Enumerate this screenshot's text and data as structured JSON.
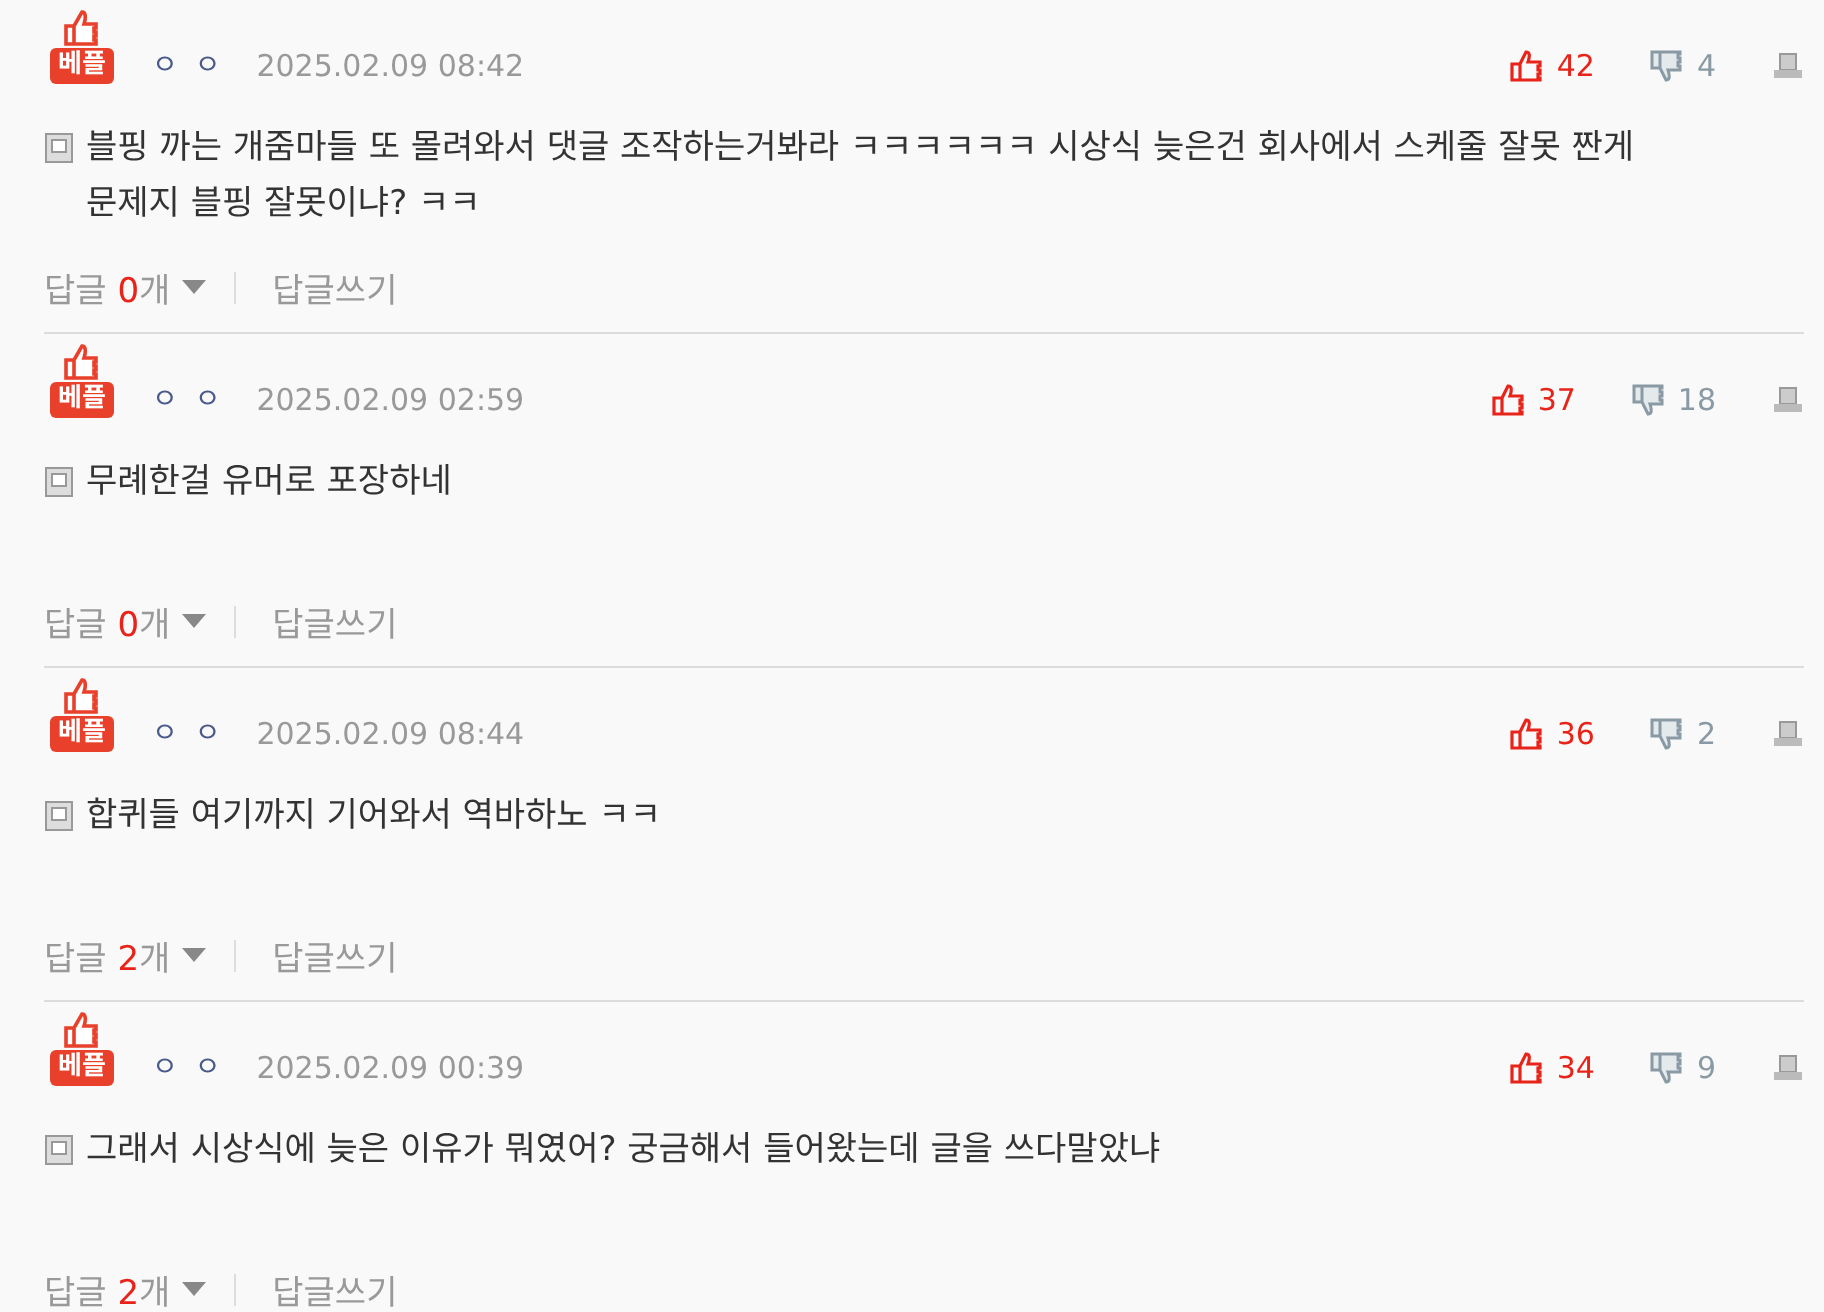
{
  "comments": [
    {
      "badge": "베플",
      "author": "ㅇ ㅇ",
      "date": "2025.02.09 08:42",
      "likes": "42",
      "dislikes": "4",
      "text": "블핑 까는 개줌마들 또 몰려와서 댓글 조작하는거봐라 ㅋㅋㅋㅋㅋㅋ 시상식 늦은건 회사에서 스케줄 잘못 짠게 문제지 블핑 잘못이냐? ㅋㅋ",
      "reply_label": "답글",
      "reply_count": "0",
      "reply_unit": "개",
      "write_reply": "답글쓰기"
    },
    {
      "badge": "베플",
      "author": "ㅇ ㅇ",
      "date": "2025.02.09 02:59",
      "likes": "37",
      "dislikes": "18",
      "text": "무례한걸 유머로 포장하네",
      "reply_label": "답글",
      "reply_count": "0",
      "reply_unit": "개",
      "write_reply": "답글쓰기"
    },
    {
      "badge": "베플",
      "author": "ㅇ ㅇ",
      "date": "2025.02.09 08:44",
      "likes": "36",
      "dislikes": "2",
      "text": "합퀴들 여기까지 기어와서 역바하노 ㅋㅋ",
      "reply_label": "답글",
      "reply_count": "2",
      "reply_unit": "개",
      "write_reply": "답글쓰기"
    },
    {
      "badge": "베플",
      "author": "ㅇ ㅇ",
      "date": "2025.02.09 00:39",
      "likes": "34",
      "dislikes": "9",
      "text": "그래서 시상식에 늦은 이유가 뭐였어? 궁금해서 들어왔는데 글을 쓰다말았냐",
      "reply_label": "답글",
      "reply_count": "2",
      "reply_unit": "개",
      "write_reply": "답글쓰기"
    }
  ]
}
